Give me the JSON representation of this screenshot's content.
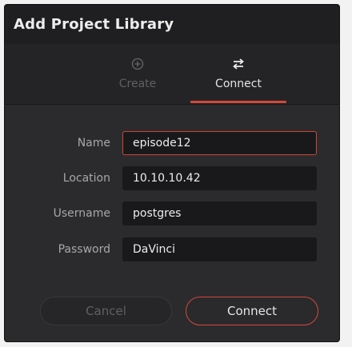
{
  "dialog": {
    "title": "Add Project Library"
  },
  "tabs": [
    {
      "label": "Create",
      "icon": "plus-circle-icon",
      "active": false
    },
    {
      "label": "Connect",
      "icon": "swap-arrows-icon",
      "active": true
    }
  ],
  "form": {
    "name": {
      "label": "Name",
      "value": "episode12"
    },
    "location": {
      "label": "Location",
      "value": "10.10.10.42"
    },
    "username": {
      "label": "Username",
      "value": "postgres"
    },
    "password": {
      "label": "Password",
      "value": "DaVinci"
    }
  },
  "buttons": {
    "cancel": "Cancel",
    "connect": "Connect"
  },
  "colors": {
    "accent": "#d4483b",
    "background": "#2b2b2d",
    "titlebar": "#1f1f21",
    "field": "#19191b"
  }
}
